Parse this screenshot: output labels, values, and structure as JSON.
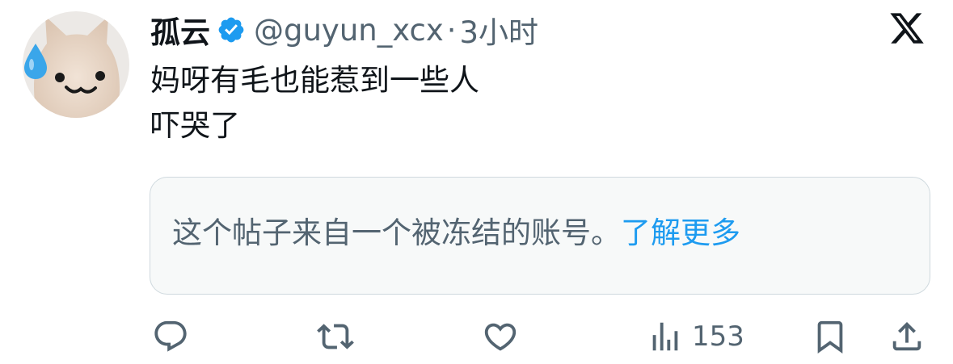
{
  "tweet": {
    "author_name": "孤云",
    "handle": "@guyun_xcx",
    "separator": "·",
    "time": "3小时",
    "lines": [
      "妈呀有毛也能惹到一些人",
      "吓哭了"
    ],
    "verified": true
  },
  "notice": {
    "text": "这个帖子来自一个被冻结的账号。",
    "link": "了解更多"
  },
  "actions": {
    "views": "153"
  },
  "icons": {
    "reply": "reply-icon",
    "retweet": "retweet-icon",
    "like": "like-icon",
    "views": "views-icon",
    "bookmark": "bookmark-icon",
    "share": "share-icon",
    "logo": "x-logo-icon"
  },
  "colors": {
    "text": "#0f1419",
    "secondary": "#536471",
    "accent": "#1d9bf0",
    "notice_bg": "#f7f9f9",
    "notice_border": "#cfd9de"
  }
}
